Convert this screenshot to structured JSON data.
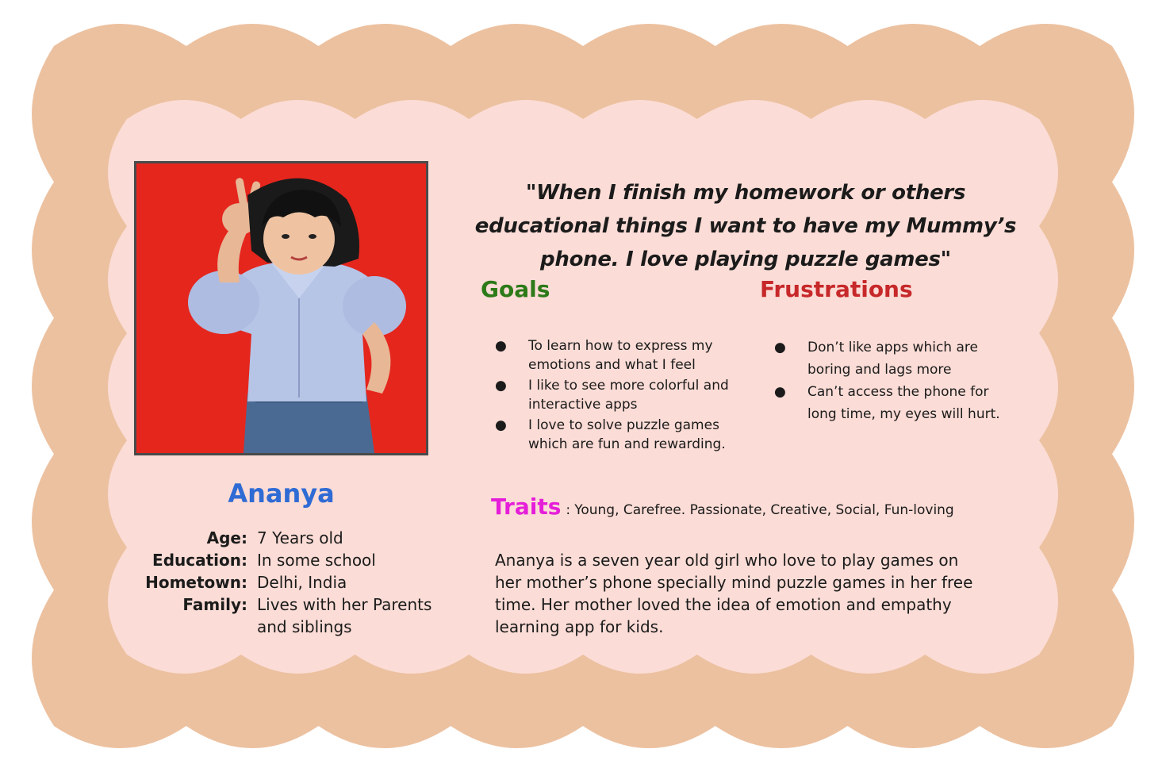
{
  "colors": {
    "outer_border": "#ecc1a0",
    "card_background": "#fbdcd6",
    "name": "#2f6bd4",
    "goals": "#2c7a18",
    "frustrations": "#c7282a",
    "traits": "#e51fd9",
    "photo_background": "#e5261d"
  },
  "persona": {
    "photo_icon": "child-portrait-image",
    "name": "Ananya",
    "facts": [
      {
        "label": "Age:",
        "value": "7 Years old"
      },
      {
        "label": "Education:",
        "value": "In some school"
      },
      {
        "label": "Hometown:",
        "value": "Delhi, India"
      },
      {
        "label": "Family:",
        "value": "Lives with her Parents and siblings"
      }
    ]
  },
  "quote": "\"When I finish my homework or others educational things I want to have my Mummy’s phone. I love playing puzzle games\"",
  "goals": {
    "heading": "Goals",
    "items": [
      "To learn how to express my emotions and what I feel",
      "I like to see more colorful and interactive apps",
      "I love to solve puzzle games which are fun and rewarding."
    ]
  },
  "frustrations": {
    "heading": "Frustrations",
    "items": [
      "Don’t  like apps which are boring and lags more",
      "Can’t access the phone for long time, my eyes will hurt."
    ]
  },
  "traits": {
    "label": "Traits",
    "separator": ":",
    "value": "Young, Carefree. Passionate, Creative, Social, Fun-loving"
  },
  "bio": "Ananya is a seven year old girl who love to play games on her mother’s  phone specially mind puzzle games in her free time. Her mother loved the idea of emotion and empathy learning app for kids.",
  "bullet_glyph": "●"
}
